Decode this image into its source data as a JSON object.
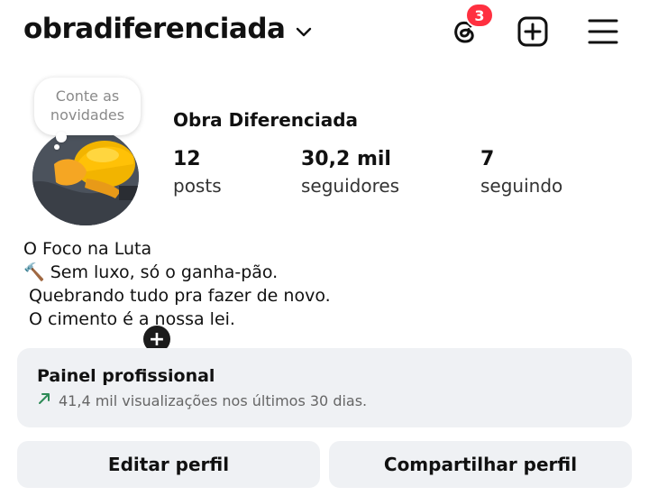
{
  "header": {
    "username": "obradiferenciada",
    "threads_badge_count": "3",
    "icons": [
      "chevron-down-icon",
      "threads-icon",
      "create-post-icon",
      "menu-icon"
    ]
  },
  "profile": {
    "note_text": "Conte as novidades",
    "display_name": "Obra Diferenciada",
    "stats": [
      {
        "value": "12",
        "label": "posts"
      },
      {
        "value": "30,2 mil",
        "label": "seguidores"
      },
      {
        "value": "7",
        "label": "seguindo"
      }
    ],
    "bio_lines": [
      "O Foco na Luta",
      "🔨 Sem luxo, só o ganha-pão.",
      " Quebrando tudo pra fazer de novo.",
      " O cimento é a nossa lei."
    ]
  },
  "dashboard": {
    "title": "Painel profissional",
    "subtitle": "41,4 mil visualizações nos últimos 30 dias."
  },
  "actions": {
    "edit_label": "Editar perfil",
    "share_label": "Compartilhar perfil"
  },
  "colors": {
    "badge": "#ff3040",
    "panel_bg": "#eff1f4",
    "trend_arrow": "#2e8b57"
  }
}
